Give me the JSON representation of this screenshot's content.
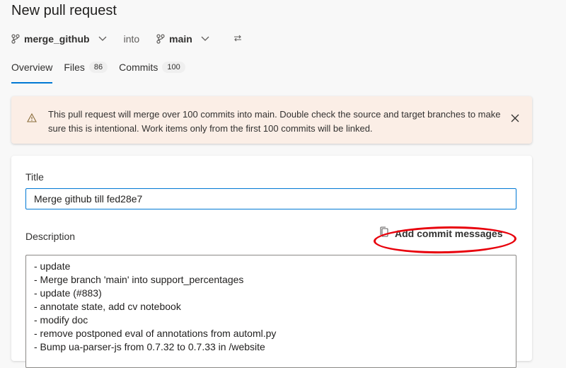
{
  "page": {
    "title": "New pull request"
  },
  "branches": {
    "source": "merge_github",
    "into_label": "into",
    "target": "main"
  },
  "tabs": [
    {
      "label": "Overview",
      "badge": null,
      "active": true
    },
    {
      "label": "Files",
      "badge": "86",
      "active": false
    },
    {
      "label": "Commits",
      "badge": "100",
      "active": false
    }
  ],
  "warning": {
    "text": "This pull request will merge over 100 commits into main. Double check the source and target branches to make sure this is intentional. Work items only from the first 100 commits will be linked."
  },
  "form": {
    "title_label": "Title",
    "title_value": "Merge github till fed28e7",
    "description_label": "Description",
    "add_commit_messages_label": "Add commit messages",
    "description_lines": [
      "- update",
      "- Merge branch 'main' into support_percentages",
      "- update (#883)",
      "- annotate state, add cv notebook",
      "- modify doc",
      "- remove postponed eval of annotations from automl.py",
      "- Bump ua-parser-js from 0.7.32 to 0.7.33 in /website"
    ]
  },
  "colors": {
    "accent": "#0078d4",
    "warning_bg": "#fbeee6",
    "annotation": "#e8000b"
  }
}
